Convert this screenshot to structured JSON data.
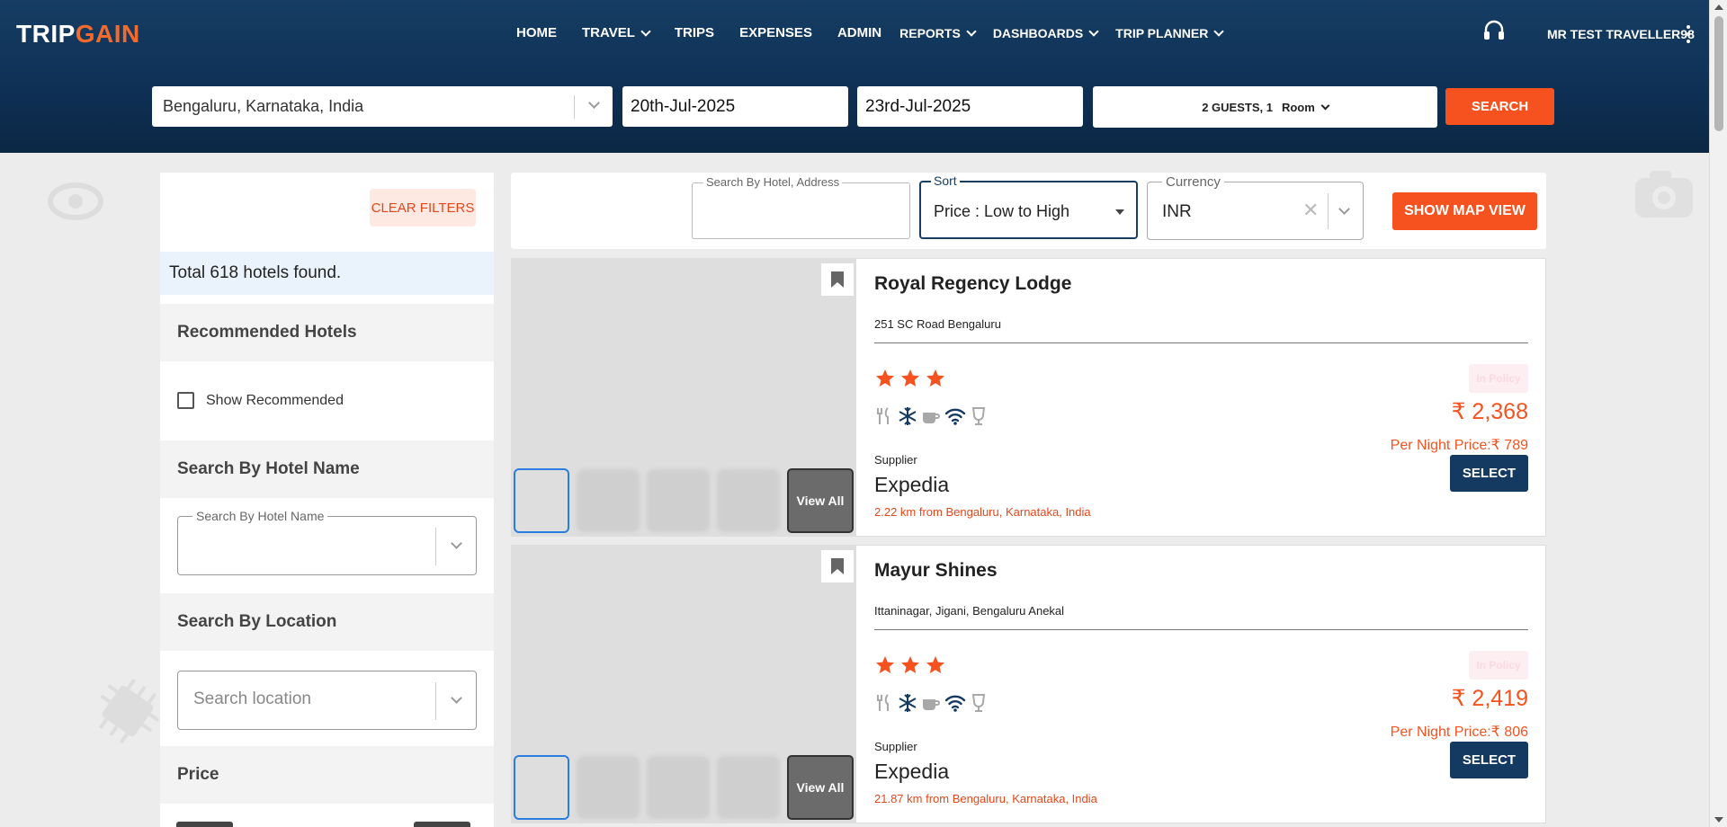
{
  "header": {
    "logo": {
      "part1": "TRIP",
      "part2": "GAIN"
    },
    "nav": [
      {
        "label": "HOME",
        "dropdown": false
      },
      {
        "label": "TRAVEL",
        "dropdown": true
      },
      {
        "label": "TRIPS",
        "dropdown": false
      },
      {
        "label": "EXPENSES",
        "dropdown": false
      },
      {
        "label": "ADMIN",
        "dropdown": false
      },
      {
        "label": "REPORTS",
        "dropdown": true
      },
      {
        "label": "DASHBOARDS",
        "dropdown": true
      },
      {
        "label": "TRIP PLANNER",
        "dropdown": true
      }
    ],
    "user_name": "MR TEST TRAVELLER98",
    "icons": {
      "support": "headset-icon",
      "menu": "kebab-menu-icon"
    }
  },
  "search": {
    "destination": "Bengaluru, Karnataka, India",
    "checkin": "20th-Jul-2025",
    "checkout": "23rd-Jul-2025",
    "guests_label": "2 GUESTS, 1",
    "room_label": "Room",
    "search_button": "SEARCH"
  },
  "filters": {
    "clear_filters": "CLEAR FILTERS",
    "total_found": "Total 618 hotels found.",
    "recommended_heading": "Recommended Hotels",
    "show_recommended": "Show Recommended",
    "show_recommended_checked": false,
    "hotel_name_heading": "Search By Hotel Name",
    "hotel_name_label": "Search By Hotel Name",
    "hotel_name_value": "",
    "location_heading": "Search By Location",
    "location_placeholder": "Search location",
    "price_heading": "Price"
  },
  "toolbar": {
    "search_hotel_label": "Search By Hotel, Address",
    "search_hotel_value": "",
    "sort_label": "Sort",
    "sort_value": "Price : Low to High",
    "currency_label": "Currency",
    "currency_value": "INR",
    "map_button": "SHOW MAP VIEW"
  },
  "hotels": [
    {
      "name": "Royal Regency Lodge",
      "address": "251 SC Road Bengaluru",
      "stars": 3,
      "amenities": [
        "restaurant-icon",
        "ac-icon",
        "coffee-icon",
        "wifi-icon",
        "bar-icon"
      ],
      "policy": "In Policy",
      "price": "₹ 2,368",
      "per_night": "Per Night Price:₹ 789",
      "supplier_label": "Supplier",
      "supplier": "Expedia",
      "distance": "2.22 km from Bengaluru, Karnataka, India",
      "select_button": "SELECT",
      "view_all": "View All"
    },
    {
      "name": "Mayur Shines",
      "address": "Ittaninagar, Jigani, Bengaluru Anekal",
      "stars": 3,
      "amenities": [
        "restaurant-icon",
        "ac-icon",
        "coffee-icon",
        "wifi-icon",
        "bar-icon"
      ],
      "policy": "In Policy",
      "price": "₹ 2,419",
      "per_night": "Per Night Price:₹ 806",
      "supplier_label": "Supplier",
      "supplier": "Expedia",
      "distance": "21.87 km from Bengaluru, Karnataka, India",
      "select_button": "SELECT",
      "view_all": "View All"
    }
  ],
  "colors": {
    "header_bg": "#0f3156",
    "accent": "#f5521f",
    "select_button": "#143a62",
    "star": "#f5521f",
    "amenity_active": "#143a62",
    "amenity_inactive": "#a8a8a8"
  }
}
